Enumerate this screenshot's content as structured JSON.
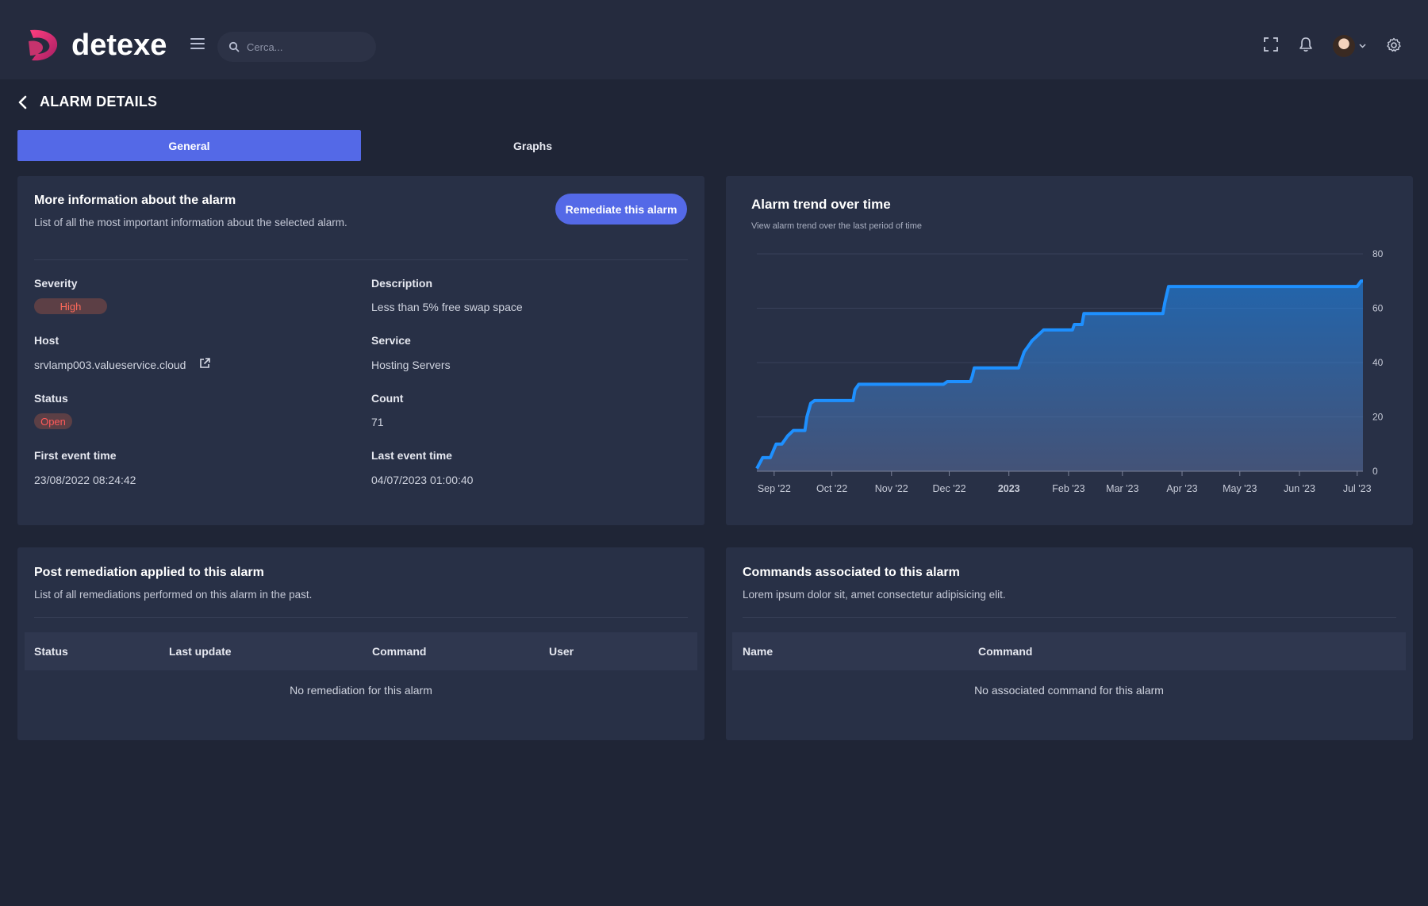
{
  "app": {
    "logo_text": "detexe",
    "search_placeholder": "Cerca..."
  },
  "page": {
    "title": "ALARM DETAILS"
  },
  "tabs": [
    {
      "label": "General",
      "active": true
    },
    {
      "label": "Graphs",
      "active": false
    }
  ],
  "info_card": {
    "title": "More information about the alarm",
    "subtitle": "List of all the most important information about the selected alarm.",
    "remediate_label": "Remediate this alarm",
    "fields": {
      "severity_label": "Severity",
      "severity_value": "High",
      "description_label": "Description",
      "description_value": "Less than 5% free swap space",
      "host_label": "Host",
      "host_value": "srvlamp003.valueservice.cloud",
      "service_label": "Service",
      "service_value": "Hosting Servers",
      "status_label": "Status",
      "status_value": "Open",
      "count_label": "Count",
      "count_value": "71",
      "first_event_label": "First event time",
      "first_event_value": "23/08/2022 08:24:42",
      "last_event_label": "Last event time",
      "last_event_value": "04/07/2023 01:00:40"
    }
  },
  "chart_card": {
    "title": "Alarm trend over time",
    "subtitle": "View alarm trend over the last period of time"
  },
  "chart_data": {
    "type": "area",
    "title": "Alarm trend over time",
    "subtitle": "View alarm trend over the last period of time",
    "xlabel": "",
    "ylabel": "",
    "ylim": [
      0,
      80
    ],
    "yticks": [
      0,
      20,
      40,
      60,
      80
    ],
    "xlim": [
      "2022-08-23",
      "2023-07-04"
    ],
    "xticks": [
      {
        "label": "Sep '22",
        "date": "2022-09-01",
        "bold": false
      },
      {
        "label": "Oct '22",
        "date": "2022-10-01",
        "bold": false
      },
      {
        "label": "Nov '22",
        "date": "2022-11-01",
        "bold": false
      },
      {
        "label": "Dec '22",
        "date": "2022-12-01",
        "bold": false
      },
      {
        "label": "2023",
        "date": "2023-01-01",
        "bold": true
      },
      {
        "label": "Feb '23",
        "date": "2023-02-01",
        "bold": false
      },
      {
        "label": "Mar '23",
        "date": "2023-03-01",
        "bold": false
      },
      {
        "label": "Apr '23",
        "date": "2023-04-01",
        "bold": false
      },
      {
        "label": "May '23",
        "date": "2023-05-01",
        "bold": false
      },
      {
        "label": "Jun '23",
        "date": "2023-06-01",
        "bold": false
      },
      {
        "label": "Jul '23",
        "date": "2023-07-01",
        "bold": false
      }
    ],
    "grid": true,
    "color": "#1e90ff",
    "series": [
      {
        "x": [
          "2022-08-23",
          "2022-08-26",
          "2022-08-30",
          "2022-09-02",
          "2022-09-05",
          "2022-09-08",
          "2022-09-11",
          "2022-09-17",
          "2022-09-18",
          "2022-09-20",
          "2022-09-22",
          "2022-10-12",
          "2022-10-13",
          "2022-10-15",
          "2022-11-28",
          "2022-11-30",
          "2022-12-12",
          "2022-12-13",
          "2022-12-14",
          "2023-01-06",
          "2023-01-07",
          "2023-01-09",
          "2023-01-11",
          "2023-01-13",
          "2023-01-19",
          "2023-02-03",
          "2023-02-04",
          "2023-02-08",
          "2023-02-09",
          "2023-03-22",
          "2023-03-23",
          "2023-03-25",
          "2023-07-01",
          "2023-07-03",
          "2023-07-04"
        ],
        "values": [
          1,
          5,
          5,
          10,
          10,
          13,
          15,
          15,
          20,
          25,
          26,
          26,
          30,
          32,
          32,
          33,
          33,
          35,
          38,
          38,
          40,
          44,
          46,
          48,
          52,
          52,
          54,
          54,
          58,
          58,
          62,
          68,
          68,
          70,
          70
        ]
      }
    ]
  },
  "remediation_card": {
    "title": "Post remediation applied to this alarm",
    "subtitle": "List of all remediations performed on this alarm in the past.",
    "columns": [
      "Status",
      "Last update",
      "Command",
      "User"
    ],
    "empty_text": "No remediation for this alarm"
  },
  "commands_card": {
    "title": "Commands associated to this alarm",
    "subtitle": "Lorem ipsum dolor sit, amet consectetur adipisicing elit.",
    "columns": [
      "Name",
      "Command"
    ],
    "empty_text": "No associated command for this alarm"
  }
}
